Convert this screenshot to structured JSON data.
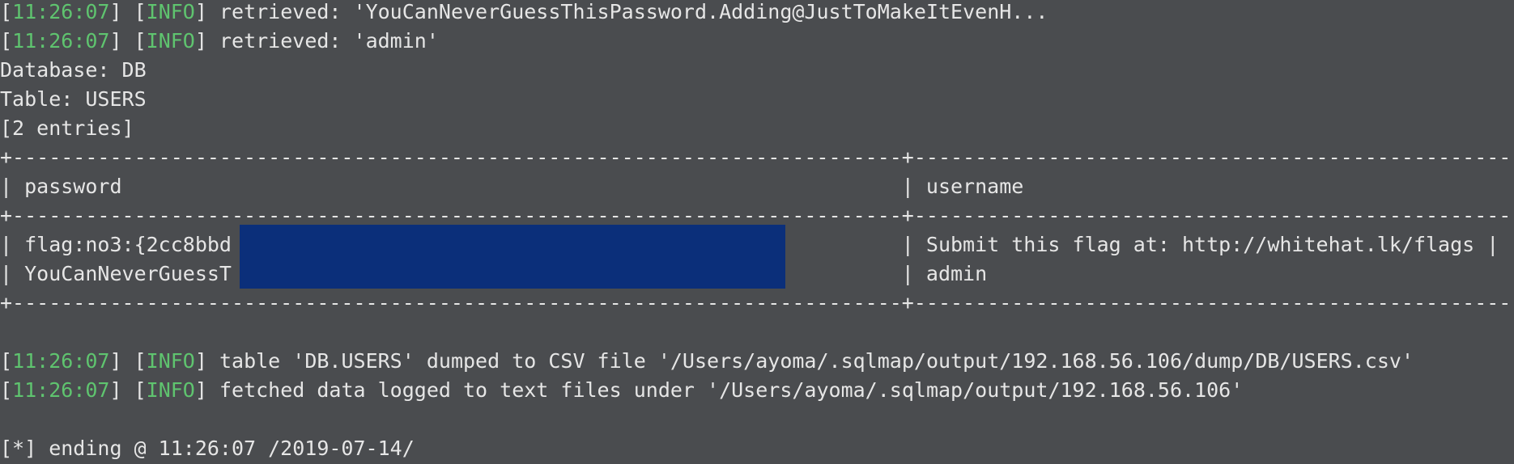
{
  "log_top": [
    {
      "time": "11:26:07",
      "level": "INFO",
      "message": "retrieved: 'YouCanNeverGuessThisPassword.Adding@JustToMakeItEvenH..."
    },
    {
      "time": "11:26:07",
      "level": "INFO",
      "message": "retrieved: 'admin'"
    }
  ],
  "meta": {
    "database": "Database: DB",
    "table": "Table: USERS",
    "entries": "[2 entries]"
  },
  "table": {
    "border": "+-------------------------------------------------------------------------+------------------------------------------------------+",
    "header": "| password                                                                | username                                             |",
    "rows": [
      "| flag:no3:{2cc8bbd                                                       | Submit this flag at: http://whitehat.lk/flags |",
      "| YouCanNeverGuessT                                                       | admin                                                |"
    ]
  },
  "log_bottom": [
    {
      "time": "11:26:07",
      "level": "INFO",
      "message": "table 'DB.USERS' dumped to CSV file '/Users/ayoma/.sqlmap/output/192.168.56.106/dump/DB/USERS.csv'"
    },
    {
      "time": "11:26:07",
      "level": "INFO",
      "message": "fetched data logged to text files under '/Users/ayoma/.sqlmap/output/192.168.56.106'"
    }
  ],
  "footer": "[*] ending @ 11:26:07 /2019-07-14/",
  "colors": {
    "background": "#4a4c4f",
    "text": "#e6e6e6",
    "info_green": "#5fc46f",
    "redaction": "#0b2f7a"
  }
}
